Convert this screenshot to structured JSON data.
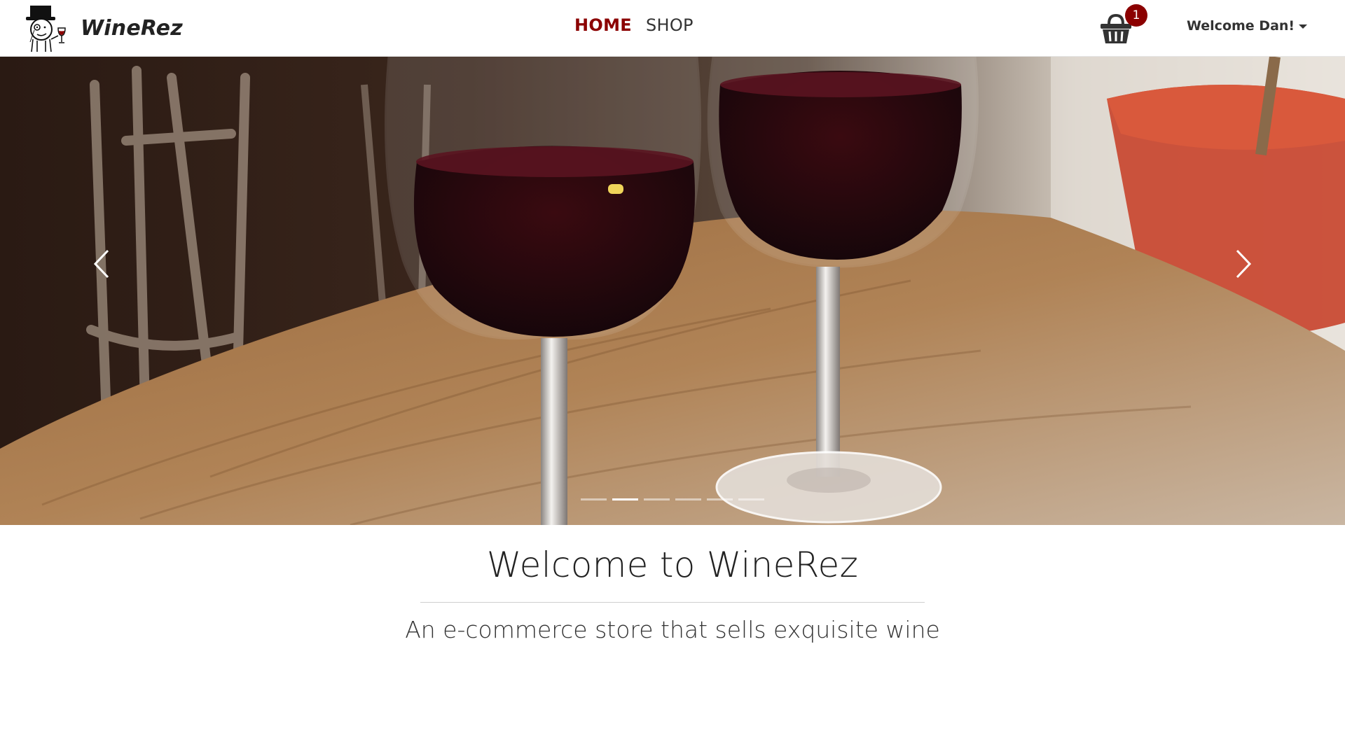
{
  "navbar": {
    "brand_name": "WineRez",
    "links": [
      {
        "label": "HOME",
        "active": true
      },
      {
        "label": "SHOP",
        "active": false
      }
    ],
    "cart_count": "1",
    "user_label": "Welcome Dan!"
  },
  "carousel": {
    "slide_count": 6,
    "active_index": 1,
    "image": "red-wine-glasses-on-wooden-table"
  },
  "welcome": {
    "title": "Welcome to WineRez",
    "subtitle": "An e-commerce store that sells exquisite wine"
  },
  "colors": {
    "accent": "#8b0000",
    "text": "#222222"
  }
}
